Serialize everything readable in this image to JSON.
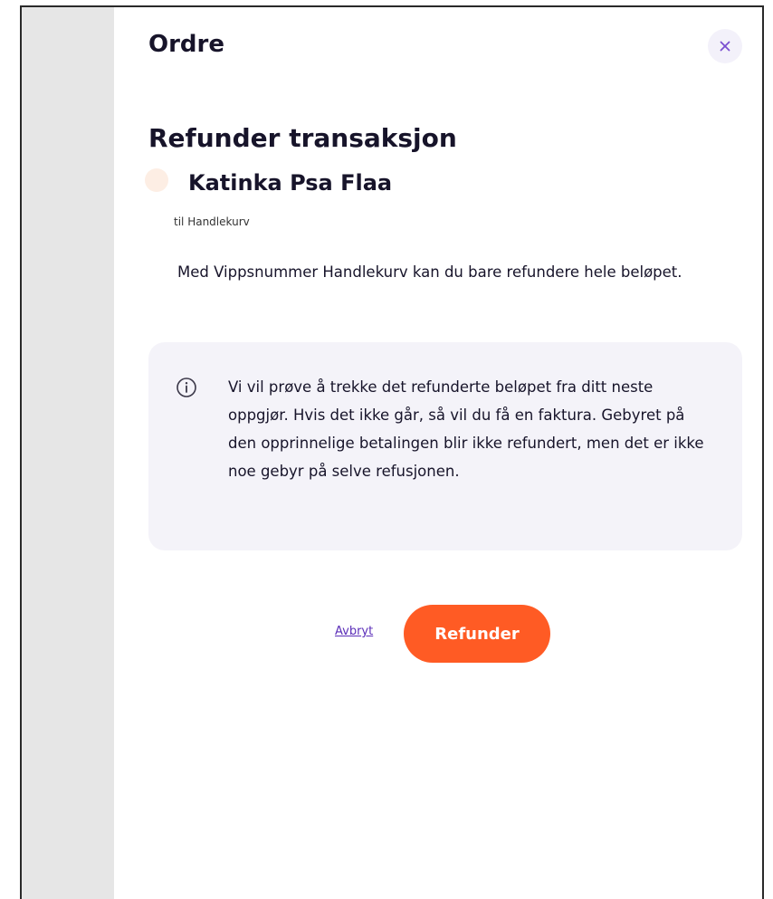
{
  "header": {
    "title": "Ordre",
    "close_icon": "close-icon"
  },
  "refund": {
    "title": "Refunder transaksjon",
    "customer_name": "Katinka Psa Flaa",
    "merchant_line": "til Handlekurv",
    "note": "Med Vippsnummer Handlekurv kan du bare refundere hele beløpet."
  },
  "info": {
    "icon": "info-icon",
    "text": "Vi vil prøve å trekke det refunderte beløpet fra ditt neste oppgjør. Hvis det ikke går, så vil du få en faktura. Gebyret på den opprinnelige betalingen blir ikke refundert, men det er ikke noe gebyr på selve refusjonen."
  },
  "actions": {
    "cancel_label": "Avbryt",
    "refund_label": "Refunder"
  },
  "colors": {
    "accent": "#ff5b24",
    "link": "#5b2eb8",
    "close_icon": "#7b4fd1",
    "info_bg": "#f4f3f9",
    "side_rail": "#e6e6e6",
    "avatar": "#fdeee4"
  }
}
